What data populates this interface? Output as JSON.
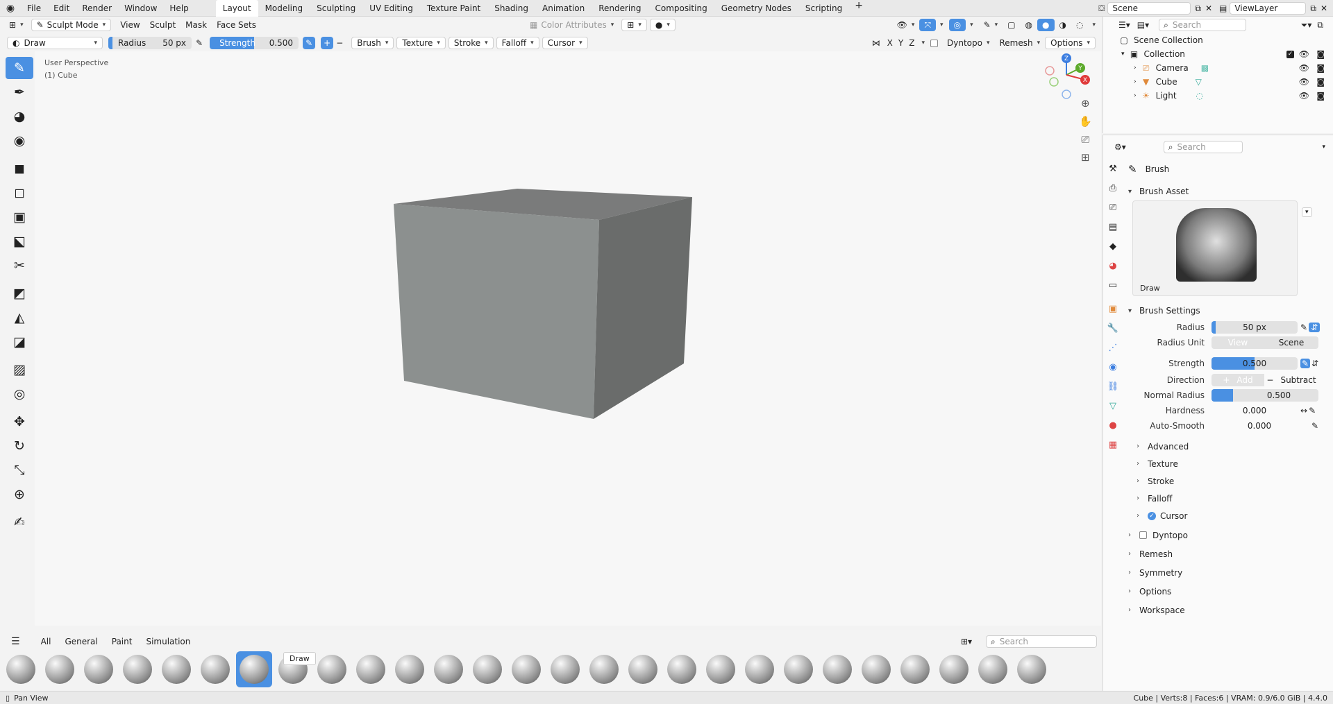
{
  "menu": [
    "File",
    "Edit",
    "Render",
    "Window",
    "Help"
  ],
  "workspaces": [
    "Layout",
    "Modeling",
    "Sculpting",
    "UV Editing",
    "Texture Paint",
    "Shading",
    "Animation",
    "Rendering",
    "Compositing",
    "Geometry Nodes",
    "Scripting"
  ],
  "active_workspace": "Layout",
  "topright": {
    "scene": "Scene",
    "viewlayer": "ViewLayer"
  },
  "viewport_header": {
    "mode": "Sculpt Mode",
    "menus": [
      "View",
      "Sculpt",
      "Mask",
      "Face Sets"
    ],
    "color_attributes": "Color Attributes",
    "search_placeholder": "Search"
  },
  "tool_header": {
    "brush_name": "Draw",
    "radius_label": "Radius",
    "radius_value": "50 px",
    "strength_label": "Strength",
    "strength_value": "0.500",
    "strength_fraction": 0.5,
    "dropdowns": [
      "Brush",
      "Texture",
      "Stroke",
      "Falloff",
      "Cursor"
    ],
    "axes": [
      "X",
      "Y",
      "Z"
    ],
    "dyntopo": "Dyntopo",
    "remesh": "Remesh",
    "options": "Options"
  },
  "viewport": {
    "perspective": "User Perspective",
    "object": "(1) Cube",
    "gizmo_axes": [
      "Z",
      "Y",
      "X"
    ]
  },
  "shelf": {
    "tabs": [
      "All",
      "General",
      "Paint",
      "Simulation"
    ],
    "tooltip": "Draw",
    "search_placeholder": "Search",
    "brush_count": 27,
    "selected_index": 6
  },
  "status": {
    "left": "Pan View",
    "right": "Cube | Verts:8 | Faces:6 | VRAM: 0.9/6.0 GiB | 4.4.0"
  },
  "outliner": {
    "search_placeholder": "Search",
    "root": "Scene Collection",
    "collection": "Collection",
    "items": [
      "Camera",
      "Cube",
      "Light"
    ]
  },
  "properties": {
    "search_placeholder": "Search",
    "title": "Brush",
    "brush_asset_title": "Brush Asset",
    "brush_asset_name": "Draw",
    "brush_settings_title": "Brush Settings",
    "rows": {
      "radius": {
        "label": "Radius",
        "value": "50 px"
      },
      "radius_unit": {
        "label": "Radius Unit",
        "a": "View",
        "b": "Scene"
      },
      "strength": {
        "label": "Strength",
        "value": "0.500",
        "fraction": 0.5
      },
      "direction": {
        "label": "Direction",
        "a": "Add",
        "b": "Subtract"
      },
      "normal_radius": {
        "label": "Normal Radius",
        "value": "0.500",
        "fraction": 0.5
      },
      "hardness": {
        "label": "Hardness",
        "value": "0.000"
      },
      "auto_smooth": {
        "label": "Auto-Smooth",
        "value": "0.000"
      }
    },
    "subpanels": [
      "Advanced",
      "Texture",
      "Stroke",
      "Falloff",
      "Cursor"
    ],
    "panels": [
      "Dyntopo",
      "Remesh",
      "Symmetry",
      "Options",
      "Workspace"
    ]
  },
  "colors": {
    "accent": "#4a90e2",
    "cube_top": "#7c7c7c",
    "cube_left": "#8b8e8d",
    "cube_right": "#6a6c6b"
  }
}
